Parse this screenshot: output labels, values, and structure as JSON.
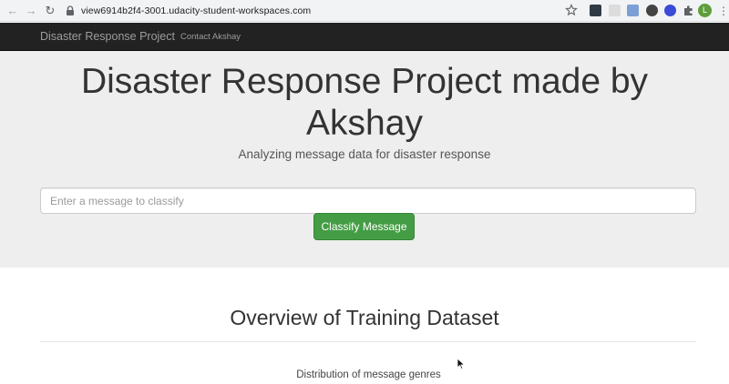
{
  "browser": {
    "url": "view6914b2f4-3001.udacity-student-workspaces.com",
    "profile_initial": "L"
  },
  "navbar": {
    "brand": "Disaster Response Project",
    "links": [
      "Contact Akshay"
    ]
  },
  "jumbotron": {
    "title": "Disaster Response Project made by Akshay",
    "subtitle": "Analyzing message data for disaster response",
    "input_placeholder": "Enter a message to classify",
    "button_label": "Classify Message"
  },
  "content": {
    "section_title": "Overview of Training Dataset",
    "plot_title": "Distribution of message genres"
  },
  "colors": {
    "navbar_bg": "#222222",
    "jumbotron_bg": "#eeeeee",
    "button_success": "#449d44"
  }
}
